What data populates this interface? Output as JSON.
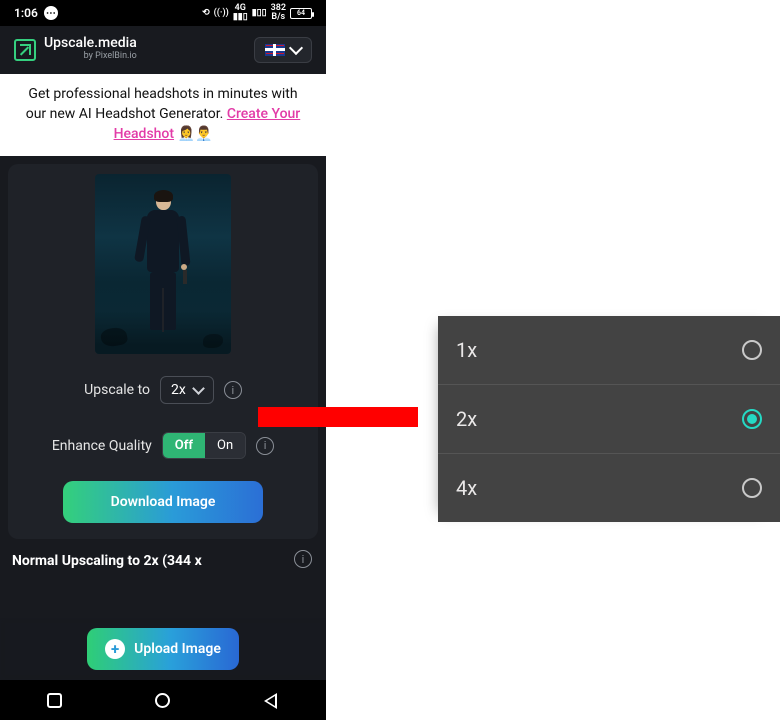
{
  "statusbar": {
    "time": "1:06",
    "net_kind": "4G",
    "signal_sub": "₁₂",
    "data_rate_top": "382",
    "data_rate_bottom": "B/s",
    "battery": "64"
  },
  "header": {
    "brand_main": "Upscale.media",
    "brand_sub": "by PixelBin.io"
  },
  "promo": {
    "line1": "Get professional headshots in minutes with",
    "line2_pre": "our new AI Headshot Generator. ",
    "link_a": "Create Your",
    "link_b": "Headshot",
    "emoji": "👩‍💼👨‍💼"
  },
  "controls": {
    "upscale_label": "Upscale to",
    "upscale_value": "2x",
    "enhance_label": "Enhance Quality",
    "enhance_off": "Off",
    "enhance_on": "On",
    "download": "Download Image"
  },
  "status": {
    "text": "Normal Upscaling to 2x (344 x"
  },
  "upload": {
    "label": "Upload Image"
  },
  "popup": {
    "options": [
      "1x",
      "2x",
      "4x"
    ],
    "selected_index": 1
  },
  "chart_data": null
}
